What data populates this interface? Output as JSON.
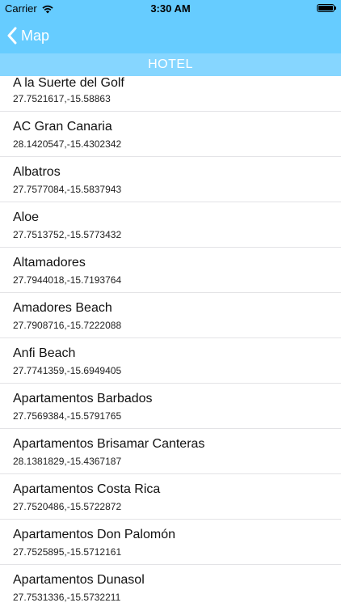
{
  "status_bar": {
    "carrier": "Carrier",
    "time": "3:30 AM",
    "wifi_icon": "wifi-icon",
    "battery_icon": "battery-icon"
  },
  "nav": {
    "back_label": "Map",
    "back_icon": "chevron-left-icon"
  },
  "section": {
    "title": "HOTEL"
  },
  "colors": {
    "nav_bg": "#66ccff",
    "section_bg": "#86d6ff",
    "text_white": "#ffffff"
  },
  "items": [
    {
      "name": "A la Suerte del Golf",
      "coords": "27.7521617,-15.58863"
    },
    {
      "name": "AC Gran Canaria",
      "coords": "28.1420547,-15.4302342"
    },
    {
      "name": "Albatros",
      "coords": "27.7577084,-15.5837943"
    },
    {
      "name": "Aloe",
      "coords": "27.7513752,-15.5773432"
    },
    {
      "name": "Altamadores",
      "coords": "27.7944018,-15.7193764"
    },
    {
      "name": "Amadores Beach",
      "coords": "27.7908716,-15.7222088"
    },
    {
      "name": "Anfi Beach",
      "coords": "27.7741359,-15.6949405"
    },
    {
      "name": "Apartamentos Barbados",
      "coords": "27.7569384,-15.5791765"
    },
    {
      "name": "Apartamentos Brisamar Canteras",
      "coords": "28.1381829,-15.4367187"
    },
    {
      "name": "Apartamentos Costa Rica",
      "coords": "27.7520486,-15.5722872"
    },
    {
      "name": "Apartamentos Don Palomón",
      "coords": "27.7525895,-15.5712161"
    },
    {
      "name": "Apartamentos Dunasol",
      "coords": "27.7531336,-15.5732211"
    }
  ]
}
